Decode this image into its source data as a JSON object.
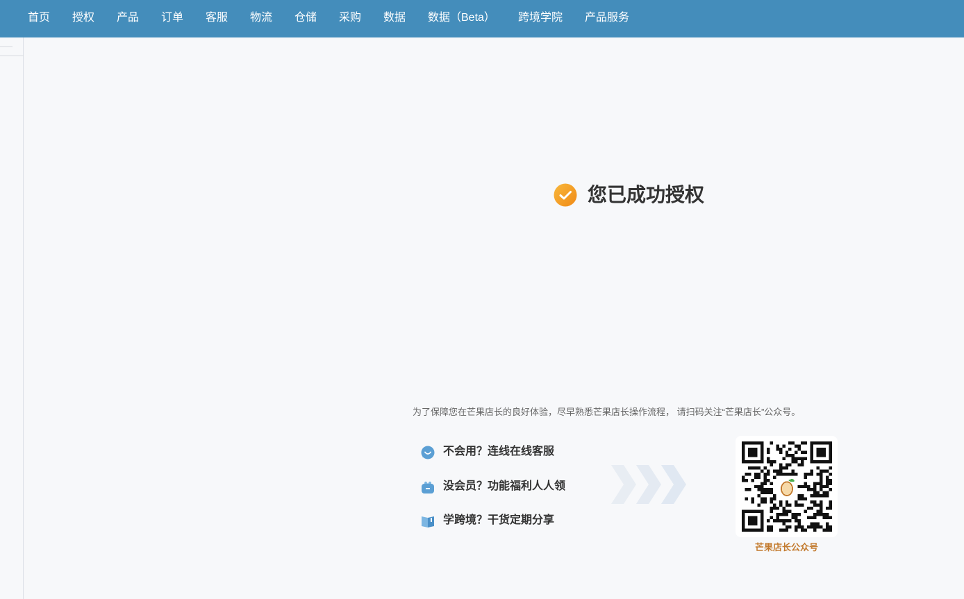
{
  "nav": {
    "items": [
      {
        "label": "首页"
      },
      {
        "label": "授权"
      },
      {
        "label": "产品"
      },
      {
        "label": "订单"
      },
      {
        "label": "客服"
      },
      {
        "label": "物流"
      },
      {
        "label": "仓储"
      },
      {
        "label": "采购"
      },
      {
        "label": "数据"
      },
      {
        "label": "数据（Beta）"
      },
      {
        "label": "跨境学院"
      },
      {
        "label": "产品服务"
      }
    ]
  },
  "success": {
    "title": "您已成功授权",
    "icon": "check-circle-icon",
    "color": "#f39b1f"
  },
  "notice": {
    "text": "为了保障您在芒果店长的良好体验，尽早熟悉芒果店长操作流程，  请扫码关注“芒果店长”公众号。"
  },
  "help": {
    "items": [
      {
        "label": "不会用？连线在线客服",
        "icon": "chat-bubble-icon"
      },
      {
        "label": "没会员？功能福利人人领",
        "icon": "gift-icon"
      },
      {
        "label": "学跨境？干货定期分享",
        "icon": "book-icon"
      }
    ]
  },
  "qr": {
    "caption": "芒果店长公众号",
    "icon": "qr-code-icon"
  },
  "colors": {
    "nav_bg": "#448dbb",
    "accent_orange": "#f39b1f",
    "caption": "#c37b2f",
    "help_icon": "#4a90c8"
  }
}
